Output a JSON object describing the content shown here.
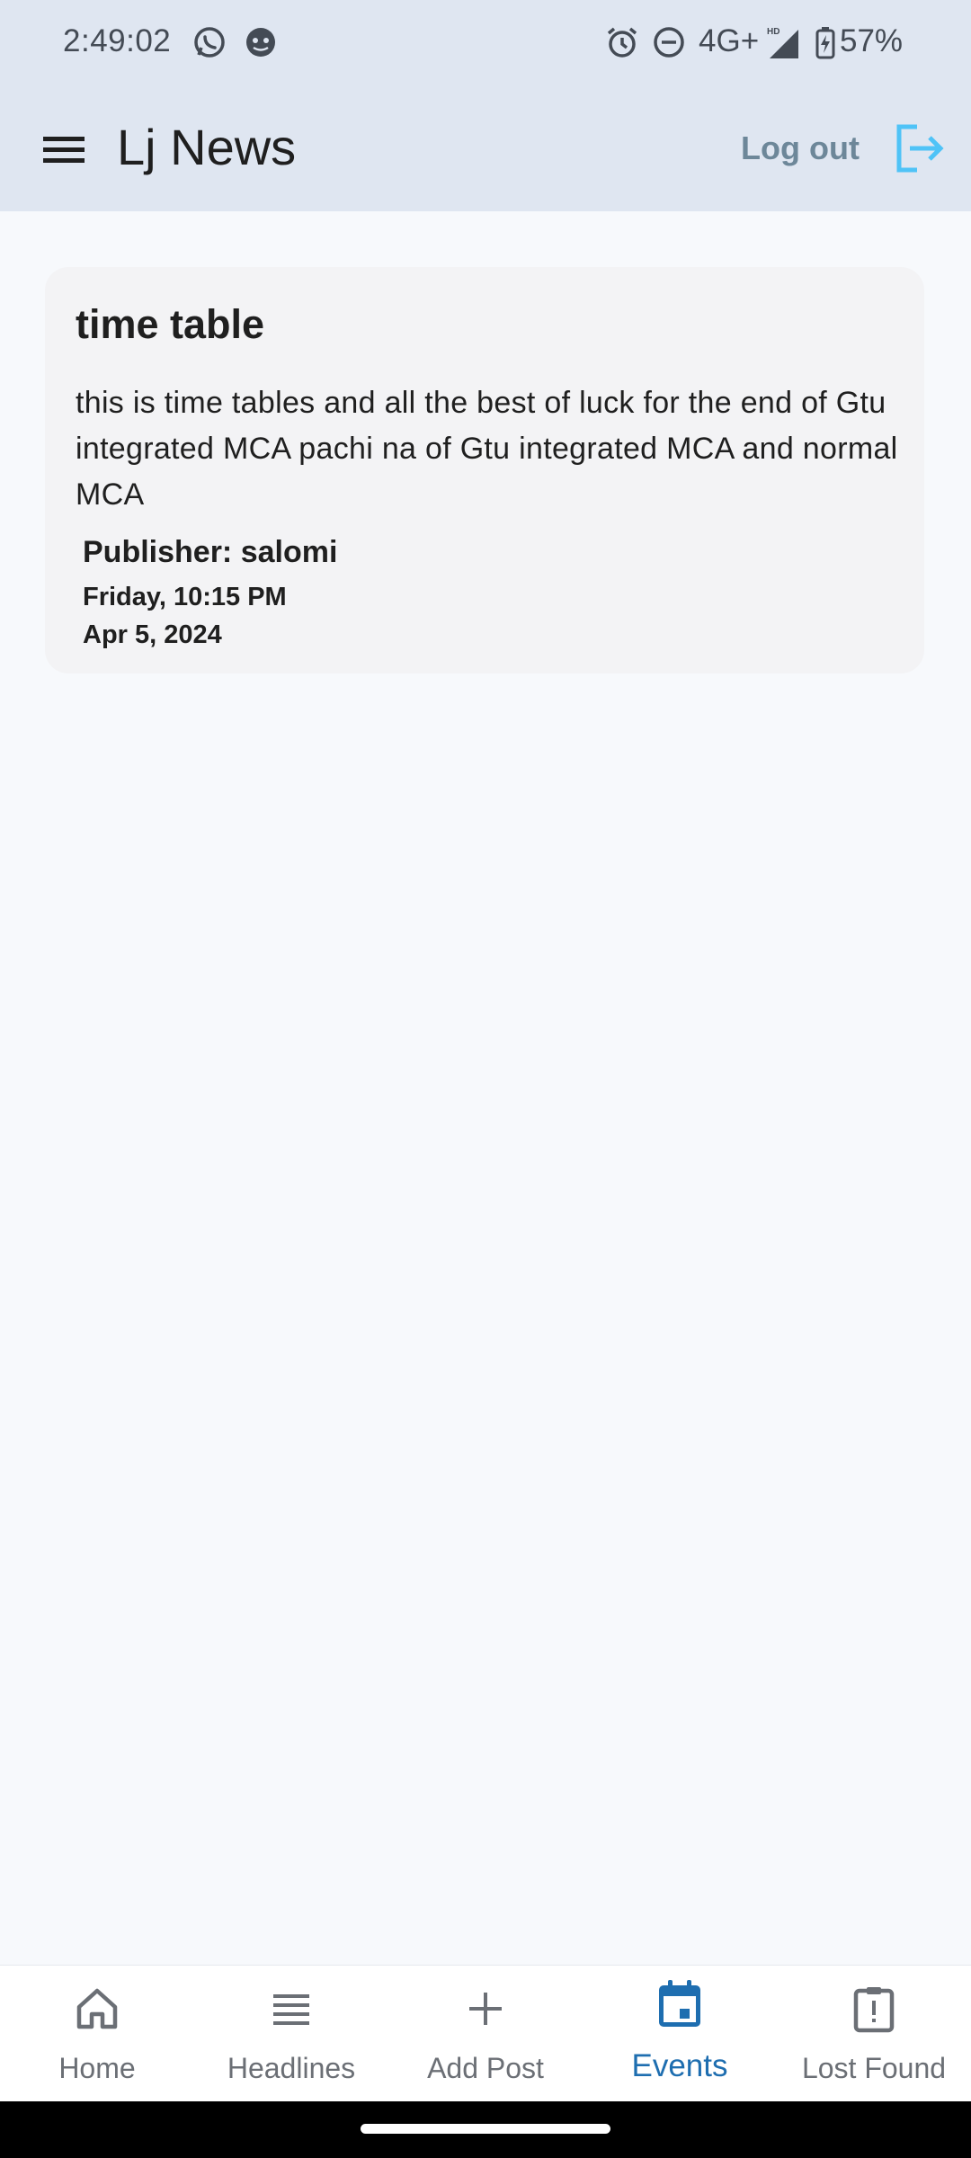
{
  "status_bar": {
    "time": "2:49:02",
    "network": "4G+",
    "battery": "57%",
    "icons": [
      "whatsapp-icon",
      "app-notification-icon",
      "alarm-icon",
      "do-not-disturb-icon",
      "hd-signal-icon",
      "battery-charging-icon"
    ]
  },
  "app_bar": {
    "title": "Lj News",
    "logout_label": "Log out",
    "logout_color": "#4fc3f7"
  },
  "post": {
    "title": "time table",
    "body": "this is time tables and all the best of luck for the end of Gtu integrated MCA pachi na of Gtu integrated MCA and normal MCA",
    "publisher": "Publisher: salomi",
    "datetime": "Friday, 10:15 PM",
    "date": "Apr 5, 2024"
  },
  "bottom_nav": {
    "items": [
      {
        "label": "Home",
        "icon": "home-icon"
      },
      {
        "label": "Headlines",
        "icon": "list-icon"
      },
      {
        "label": "Add Post",
        "icon": "plus-icon"
      },
      {
        "label": "Events",
        "icon": "calendar-icon",
        "active": true
      },
      {
        "label": "Lost Found",
        "icon": "report-icon"
      }
    ],
    "active_color": "#1e6eb0",
    "inactive_color": "#6b6f75"
  }
}
